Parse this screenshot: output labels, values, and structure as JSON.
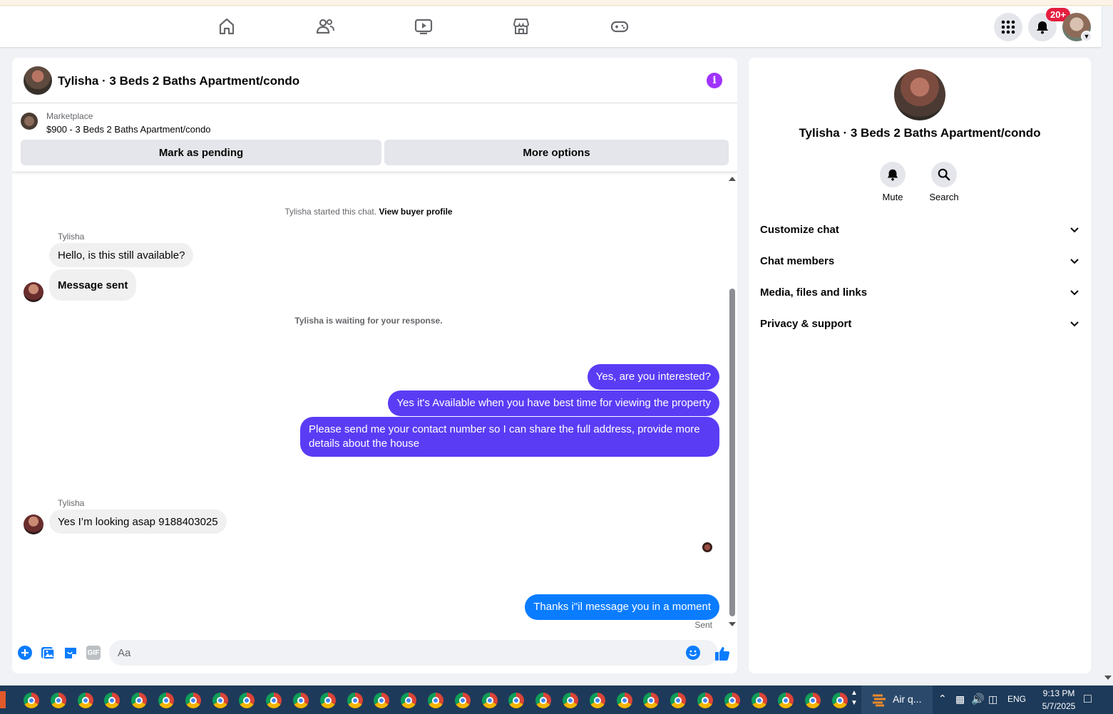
{
  "nav": {
    "icons": [
      "home-icon",
      "friends-icon",
      "video-icon",
      "marketplace-icon",
      "gaming-icon"
    ],
    "notifications_badge": "20+"
  },
  "chat": {
    "title": "Tylisha · 3 Beds 2 Baths Apartment/condo",
    "marketplace_label": "Marketplace",
    "listing": "$900 - 3 Beds 2 Baths Apartment/condo",
    "mark_pending_label": "Mark as pending",
    "more_options_label": "More options",
    "started_text": "Tylisha started this chat.",
    "view_buyer_profile": "View buyer profile",
    "waiting_text": "Tylisha is waiting for your response.",
    "sender_name": "Tylisha",
    "incoming_1": "Hello, is this still available?",
    "incoming_2": "Message sent",
    "outgoing_1": "Yes, are you interested?",
    "outgoing_2": "Yes it's Available when you have best time for viewing the property",
    "outgoing_3": "Please send me your contact number so I can share the full address, provide more details about the house",
    "incoming_3": "Yes I’m looking asap 9188403025",
    "outgoing_4": "Thanks i\"il message you in a moment",
    "sent_status": "Sent",
    "composer_placeholder": "Aa",
    "gif_label": "GIF",
    "accent_color": "#5b3cf5",
    "blue_color": "#0a7cff"
  },
  "details": {
    "title": "Tylisha · 3 Beds 2 Baths Apartment/condo",
    "mute_label": "Mute",
    "search_label": "Search",
    "sections": [
      "Customize chat",
      "Chat members",
      "Media, files and links",
      "Privacy & support"
    ]
  },
  "taskbar": {
    "weather_text": "Air q...",
    "language": "ENG",
    "time": "9:13 PM",
    "date": "5/7/2025"
  }
}
